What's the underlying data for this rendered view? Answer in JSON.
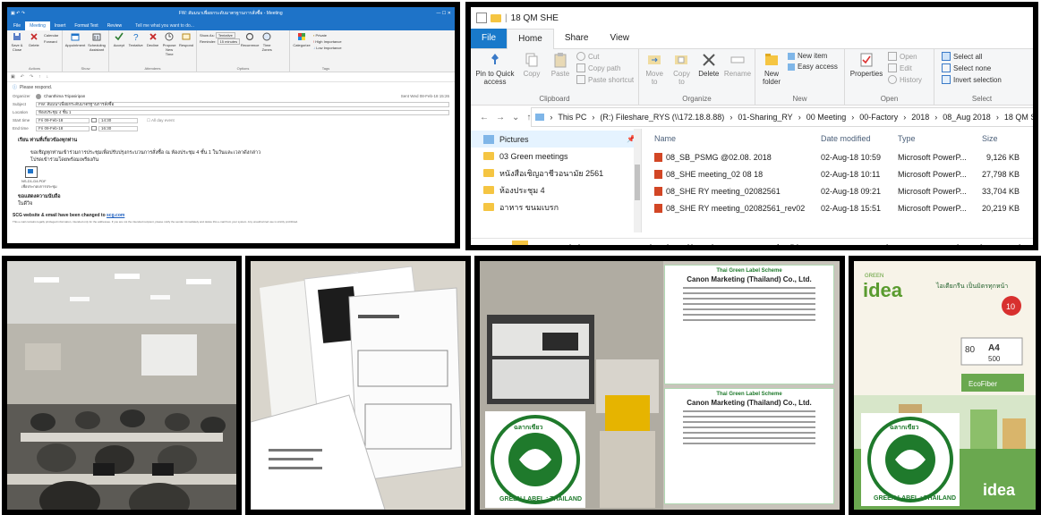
{
  "outlook": {
    "window_title": "FW: สัมมนาเพื่อยกระดับมาตรฐานการสั่งซื้อ - Meeting",
    "tabs": [
      "File",
      "Meeting",
      "Insert",
      "Format Text",
      "Review"
    ],
    "active_tab": "Meeting",
    "tell_me": "Tell me what you want to do...",
    "ribbon_groups": [
      {
        "label": "Actions",
        "buttons": [
          "Save & Close",
          "Delete",
          "Forward"
        ],
        "small": [
          "Calendar"
        ]
      },
      {
        "label": "Show",
        "buttons": [
          "Appointment",
          "Scheduling Assistant"
        ]
      },
      {
        "label": "Attendees",
        "buttons": [
          "Accept",
          "Tentative",
          "Decline",
          "Propose New Time",
          "Respond"
        ]
      },
      {
        "label": "Options",
        "small": [
          "Show As:",
          "Tentative",
          "Reminder:",
          "15 minutes"
        ],
        "buttons": [
          "Recurrence",
          "Time Zones"
        ]
      },
      {
        "label": "Tags",
        "buttons": [
          "Categorize"
        ],
        "small": [
          "Private",
          "High Importance",
          "Low Importance"
        ]
      }
    ],
    "respond_text": "Please respond.",
    "organizer_label": "Organizer",
    "organizer_value": "Chanthima Tripasiripan",
    "sent_info": "Sent   Wed 08-Feb-18 15:26",
    "subject_label": "Subject",
    "subject_value": "FW: สัมมนาเพื่อยกระดับมาตรฐานการสั่งซื้อ",
    "location_label": "Location",
    "location_value": "ห้องประชุม 4 ชั้น 1",
    "start_label": "Start time",
    "start_date": "Fri 09-Feb-18",
    "start_time": "14:30",
    "end_label": "End time",
    "end_date": "Fri 09-Feb-18",
    "end_time": "16:30",
    "all_day": "All day event",
    "salutation": "เรียน ท่านที่เกี่ยวข้องทุกท่าน",
    "body_line1": "ขอเชิญทุกท่านเข้าร่วมการประชุมเพื่อปรับปรุงกระบวนการสั่งซื้อ ณ ห้องประชุม 4 ชั้น 1 ในวันและเวลาดังกล่าว",
    "body_line2": "โปรดเข้าร่วมโดยพร้อมเพรียงกัน",
    "attachment_name": "NS-D1-D4.PDF",
    "attachment_note": "เพื่อประกอบการประชุม",
    "signoff": "ขอแสดงความนับถือ",
    "signoff_name": "ในดีวิจ",
    "scg_notice": "SCG website & email have been changed to",
    "scg_link": "scg.com",
    "disclaimer": "This e-mail contains legally privileged information, intended only for the addressee. If you are not the intended recipient, please notify the sender immediately and delete this e-mail from your system. Any unauthorized use is strictly prohibited."
  },
  "explorer": {
    "title": "18 QM SHE",
    "tabs": [
      "File",
      "Home",
      "Share",
      "View"
    ],
    "active_tab": "Home",
    "clipboard": {
      "pin": "Pin to Quick access",
      "copy": "Copy",
      "paste": "Paste",
      "cut": "Cut",
      "copy_path": "Copy path",
      "paste_shortcut": "Paste shortcut",
      "label": "Clipboard"
    },
    "organize": {
      "move": "Move to",
      "copy": "Copy to",
      "delete": "Delete",
      "rename": "Rename",
      "label": "Organize"
    },
    "new": {
      "folder": "New folder",
      "item": "New item",
      "easy": "Easy access",
      "label": "New"
    },
    "open": {
      "properties": "Properties",
      "open": "Open",
      "edit": "Edit",
      "history": "History",
      "label": "Open"
    },
    "select": {
      "all": "Select all",
      "none": "Select none",
      "invert": "Invert selection",
      "label": "Select"
    },
    "path": [
      "This PC",
      "(R:) Fileshare_RYS (\\\\172.18.8.88)",
      "01-Sharing_RY",
      "00 Meeting",
      "00-Factory",
      "2018",
      "08_Aug 2018",
      "18 QM SHE"
    ],
    "tree": [
      {
        "label": "Pictures",
        "kind": "pictures"
      },
      {
        "label": "03 Green meetings",
        "kind": "folder"
      },
      {
        "label": "หนังสือเชิญอาชีวอนามัย 2561",
        "kind": "folder"
      },
      {
        "label": "ห้องประชุม 4",
        "kind": "folder"
      },
      {
        "label": "อาหาร ขนมเบรก",
        "kind": "folder"
      }
    ],
    "columns": {
      "name": "Name",
      "date": "Date modified",
      "type": "Type",
      "size": "Size"
    },
    "files": [
      {
        "name": "08_SB_PSMG @02.08. 2018",
        "date": "02-Aug-18 10:59",
        "type": "Microsoft PowerP...",
        "size": "9,126 KB"
      },
      {
        "name": "08_SHE meeting_02 08 18",
        "date": "02-Aug-18 10:11",
        "type": "Microsoft PowerP...",
        "size": "27,798 KB"
      },
      {
        "name": "08_SHE RY meeting_02082561",
        "date": "02-Aug-18 09:21",
        "type": "Microsoft PowerP...",
        "size": "33,704 KB"
      },
      {
        "name": "08_SHE RY meeting_02082561_rev02",
        "date": "02-Aug-18 15:51",
        "type": "Microsoft PowerP...",
        "size": "20,219 KB"
      }
    ],
    "zoom_path": [
      "This PC",
      "(S:) Fileshare_SB$ (\\\\172.18.8.55)",
      "01-Sharing_sb"
    ]
  },
  "printer": {
    "cert_title": "Thai Green Label Scheme",
    "cert_company": "Canon Marketing (Thailand) Co., Ltd.",
    "seal_thai": "ฉลากเขียว",
    "seal_en": "GREEN LABEL : THAILAND"
  },
  "paper": {
    "brand": "idea",
    "brand_tag": "GREEN",
    "headline": "ไอเดียกรีน เป็นมิตรทุกหน้า",
    "size": "A4",
    "weight": "80",
    "sheets": "500",
    "ecofiber": "EcoFiber",
    "brand_foot": "idea",
    "seal_thai": "ฉลากเขียว",
    "seal_en": "GREEN LABEL : THAILAND",
    "badge": "10"
  },
  "colors": {
    "outlook_blue": "#1e73c8",
    "explorer_blue": "#1979ca",
    "green_label": "#1f7a2c",
    "ppt_red": "#d24625"
  }
}
